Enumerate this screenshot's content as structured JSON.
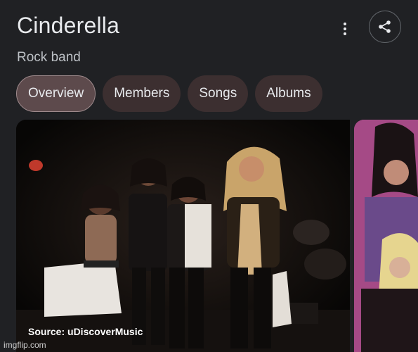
{
  "header": {
    "title": "Cinderella",
    "subtitle": "Rock band"
  },
  "icons": {
    "more": "more-vert-icon",
    "share": "share-icon"
  },
  "tabs": [
    {
      "label": "Overview",
      "active": true
    },
    {
      "label": "Members",
      "active": false
    },
    {
      "label": "Songs",
      "active": false
    },
    {
      "label": "Albums",
      "active": false
    }
  ],
  "images": {
    "source": "Source: uDiscoverMusic"
  },
  "watermark": "imgflip.com",
  "colors": {
    "background": "#202124",
    "tab_bg": "#3c2f30",
    "tab_active_bg": "#5d4a4c",
    "second_image_bg": "#a54a86"
  }
}
